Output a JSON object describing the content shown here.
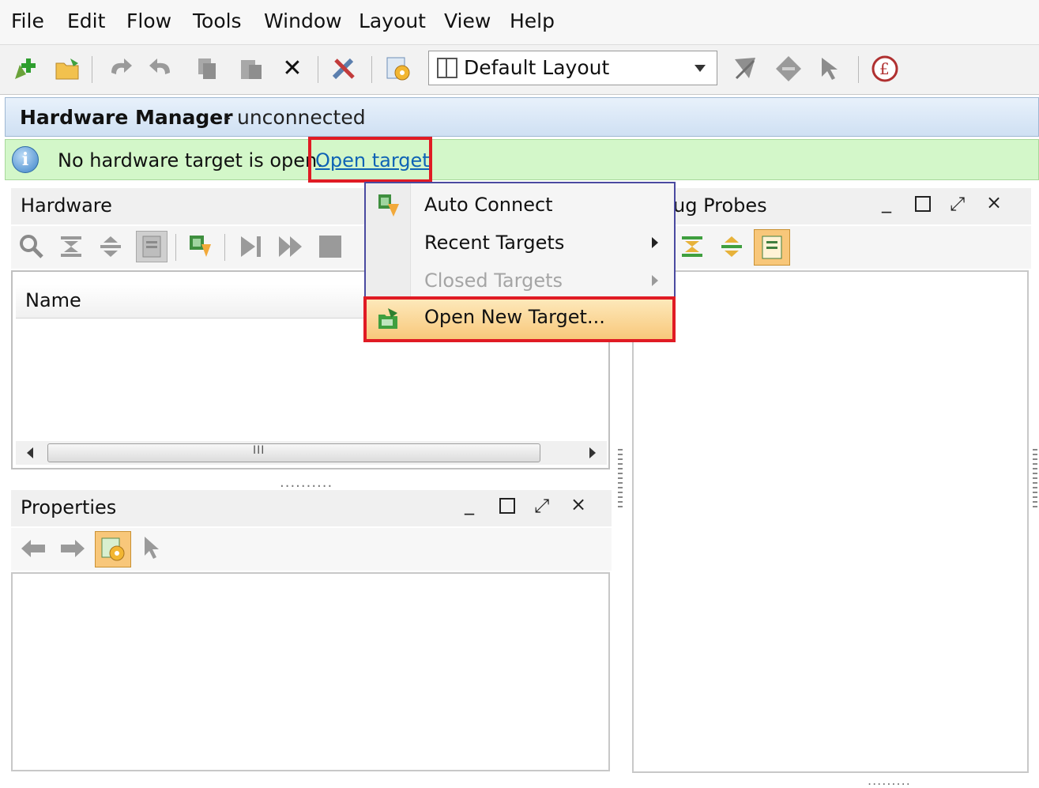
{
  "menubar": {
    "items": [
      "File",
      "Edit",
      "Flow",
      "Tools",
      "Window",
      "Layout",
      "View",
      "Help"
    ]
  },
  "toolbar": {
    "icons": [
      "add-sources-icon",
      "open-folder-icon",
      "undo-icon",
      "redo-icon",
      "copy-icon",
      "paste-icon",
      "delete-icon",
      "settings-tools-icon",
      "project-settings-icon",
      "layout-icon",
      "cursor-icon",
      "marker-icon",
      "pointer-icon",
      "help-icon"
    ],
    "layout_select": {
      "value": "Default Layout"
    }
  },
  "hardware_manager": {
    "title": "Hardware Manager",
    "status": "- unconnected"
  },
  "infobar": {
    "message": "No hardware target is open.",
    "link": "Open target"
  },
  "hardware_panel": {
    "title": "Hardware",
    "column_name": "Name",
    "scroll_grip": "III"
  },
  "properties_panel": {
    "title": "Properties"
  },
  "debug_probes_panel": {
    "title": "ug Probes"
  },
  "context_menu": {
    "items": [
      {
        "label": "Auto Connect",
        "enabled": true,
        "submenu": false
      },
      {
        "label": "Recent Targets",
        "enabled": true,
        "submenu": true
      },
      {
        "label": "Closed Targets",
        "enabled": false,
        "submenu": true
      },
      {
        "label": "Open New Target...",
        "enabled": true,
        "submenu": false,
        "highlighted": true
      }
    ]
  },
  "colors": {
    "infobar_bg": "#d3f7c9",
    "header_bg": "#cfe0f3",
    "highlight_red": "#e01b24",
    "link_blue": "#0f63b5",
    "menu_hover": "#f8c77a"
  }
}
